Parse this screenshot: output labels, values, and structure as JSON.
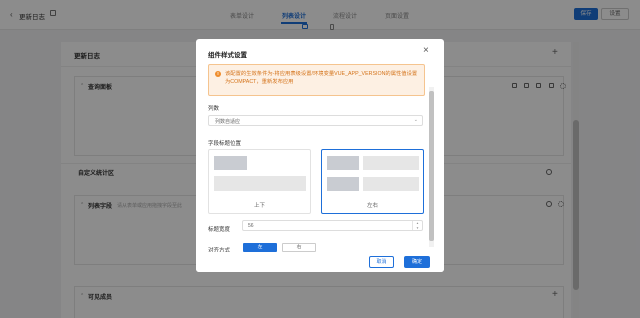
{
  "topbar": {
    "back_label": "‹",
    "title": "更新日志",
    "tabs": [
      {
        "label": "表单设计"
      },
      {
        "label": "列表设计"
      },
      {
        "label": "流程设计"
      },
      {
        "label": "页面设置"
      }
    ],
    "active_tab": "列表设计",
    "save_label": "保存",
    "more_label": "设置"
  },
  "editor": {
    "title": "更新日志",
    "sections": [
      {
        "title": "查询面板"
      },
      {
        "title": "自定义统计区"
      },
      {
        "title": "列表字段",
        "hint": "请从表单或应用拖拽字段至此"
      },
      {
        "title": "可见成员"
      }
    ]
  },
  "modal": {
    "title": "组件样式设置",
    "close_label": "×",
    "warning": "该配置的生效条件为-将应用表级设置/环境变量VUE_APP_VERSION的属性值设置为COMPACT，重新发布应用",
    "columns_label": "列数",
    "columns_value": "列数自适应",
    "columns_arrow": "⌄",
    "label_position_label": "字段标题位置",
    "option_top_bottom": "上下",
    "option_left_right": "左右",
    "label_width_label": "标题宽度",
    "label_width_value": "56",
    "align_label": "对齐方式",
    "align_left": "左",
    "align_right": "右",
    "cancel_label": "取消",
    "ok_label": "确定"
  },
  "colors": {
    "primary": "#1e6fd9",
    "warning": "#ef8d2c"
  }
}
